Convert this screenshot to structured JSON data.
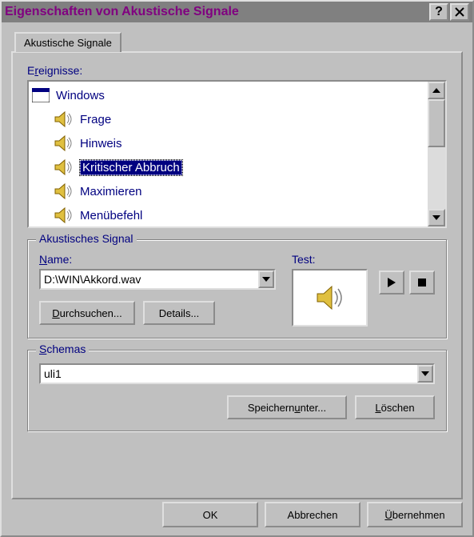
{
  "title": "Eigenschaften von Akustische Signale",
  "tab": {
    "label": "Akustische Signale"
  },
  "events": {
    "label_pre": "E",
    "label_ul": "r",
    "label_post": "eignisse:",
    "root": "Windows",
    "items": [
      "Frage",
      "Hinweis",
      "Kritischer Abbruch",
      "Maximieren",
      "Menübefehl"
    ],
    "selected_index": 2
  },
  "signal": {
    "group_label": "Akustisches Signal",
    "name_pre": "",
    "name_ul": "N",
    "name_post": "ame:",
    "test_label": "Test:",
    "file": "D:\\WIN\\Akkord.wav",
    "browse_pre": "",
    "browse_ul": "D",
    "browse_post": "urchsuchen...",
    "details": "Details..."
  },
  "schemas": {
    "group_pre": "",
    "group_ul": "S",
    "group_post": "chemas",
    "value": "uli1",
    "save_pre": "Speichern ",
    "save_ul": "u",
    "save_post": "nter...",
    "delete_pre": "",
    "delete_ul": "L",
    "delete_post": "öschen"
  },
  "footer": {
    "ok": "OK",
    "cancel": "Abbrechen",
    "apply_pre": "",
    "apply_ul": "Ü",
    "apply_post": "bernehmen"
  }
}
